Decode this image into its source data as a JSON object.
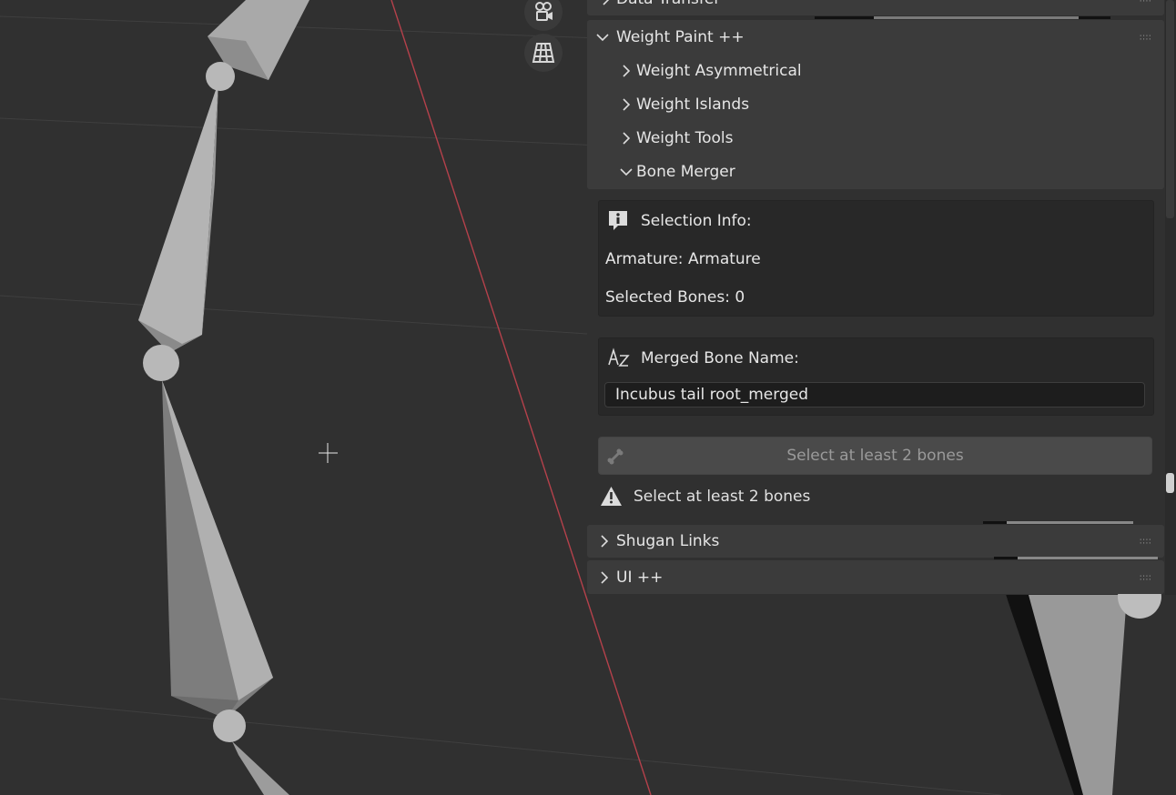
{
  "panels": {
    "data_transfer_label": "Data Transfer",
    "weight_paint_label": "Weight Paint ++",
    "sub_items": [
      "Weight Asymmetrical",
      "Weight Islands",
      "Weight Tools",
      "Bone Merger"
    ],
    "shugan_label": "Shugan Links",
    "ui_label": "UI ++"
  },
  "bone_merger": {
    "selection_title": "Selection Info:",
    "armature_text": "Armature: Armature",
    "selected_text": "Selected Bones: 0",
    "merged_title": "Merged Bone Name:",
    "merged_value": "Incubus tail root_merged",
    "button_label": "Select at least 2 bones",
    "warning_text": "Select at least 2 bones"
  },
  "icons": [
    "camera-icon",
    "grid-icon",
    "chevron-right-icon",
    "chevron-down-icon",
    "info-icon",
    "az-sort-icon",
    "bone-icon",
    "warning-icon",
    "crosshair-icon"
  ],
  "colors": {
    "viewport_bg": "#303030",
    "panel_bg": "#3b3b3b",
    "axis_red": "#b5414b"
  }
}
